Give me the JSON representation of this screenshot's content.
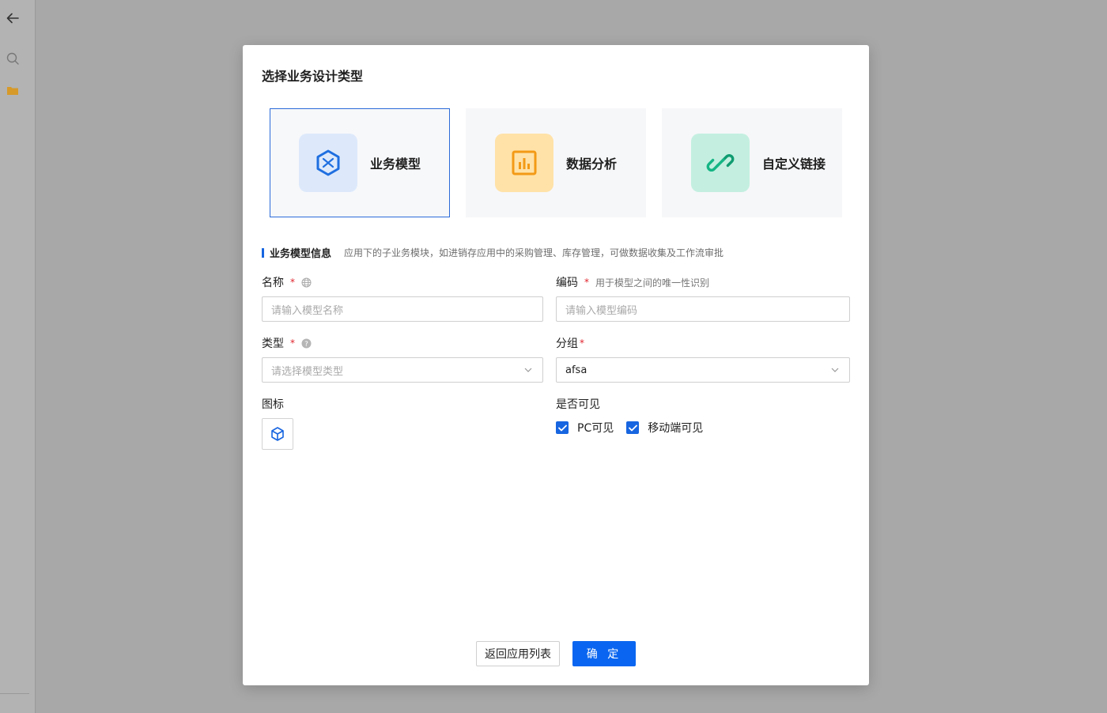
{
  "modal": {
    "title": "选择业务设计类型",
    "type_cards": [
      {
        "label": "业务模型",
        "icon": "hexagon-model-icon",
        "selected": true
      },
      {
        "label": "数据分析",
        "icon": "bar-chart-icon",
        "selected": false
      },
      {
        "label": "自定义链接",
        "icon": "link-icon",
        "selected": false
      }
    ],
    "section": {
      "title": "业务模型信息",
      "description": "应用下的子业务模块，如进销存应用中的采购管理、库存管理，可做数据收集及工作流审批"
    },
    "fields": {
      "name": {
        "label": "名称",
        "required_mark": "*",
        "placeholder": "请输入模型名称"
      },
      "code": {
        "label": "编码",
        "required_mark": "*",
        "hint": "用于模型之间的唯一性识别",
        "placeholder": "请输入模型编码"
      },
      "type": {
        "label": "类型",
        "required_mark": "*",
        "placeholder": "请选择模型类型"
      },
      "group": {
        "label": "分组",
        "required_mark": "*",
        "value": "afsa"
      },
      "icon": {
        "label": "图标"
      },
      "visibility": {
        "label": "是否可见",
        "options": [
          {
            "label": "PC可见",
            "checked": true
          },
          {
            "label": "移动端可见",
            "checked": true
          }
        ]
      }
    },
    "buttons": {
      "back": "返回应用列表",
      "confirm": "确 定"
    }
  },
  "colors": {
    "primary": "#0a66f0",
    "selected_border": "#2c6bd9",
    "required": "#e0242d",
    "model_icon_bg": "#dde9fb",
    "analysis_icon_bg": "#ffe2a8",
    "link_icon_bg": "#c4efe0"
  }
}
